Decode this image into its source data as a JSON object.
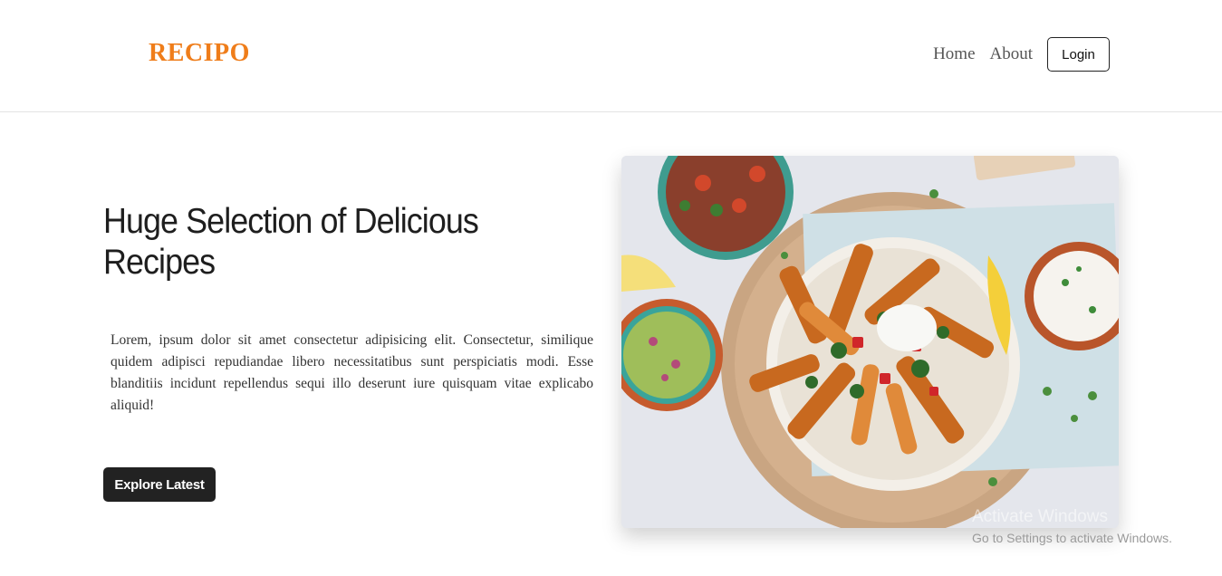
{
  "nav": {
    "brand": "RECIPO",
    "links": [
      "Home",
      "About"
    ],
    "login_label": "Login"
  },
  "hero": {
    "title": "Huge Selection of Delicious Recipes",
    "text": "Lorem, ipsum dolor sit amet consectetur adipisicing elit. Consectetur, similique quidem adipisci repudiandae libero necessitatibus sunt perspiciatis modi. Esse blanditiis incidunt repellendus sequi illo deserunt iure quisquam vitae explicabo aliquid!",
    "cta_label": "Explore Latest",
    "image_alt": "food-photo"
  },
  "os_watermark": {
    "title": "Activate Windows",
    "subtitle": "Go to Settings to activate Windows."
  },
  "colors": {
    "brand": "#ef7d1a",
    "cta_bg": "#222222"
  }
}
